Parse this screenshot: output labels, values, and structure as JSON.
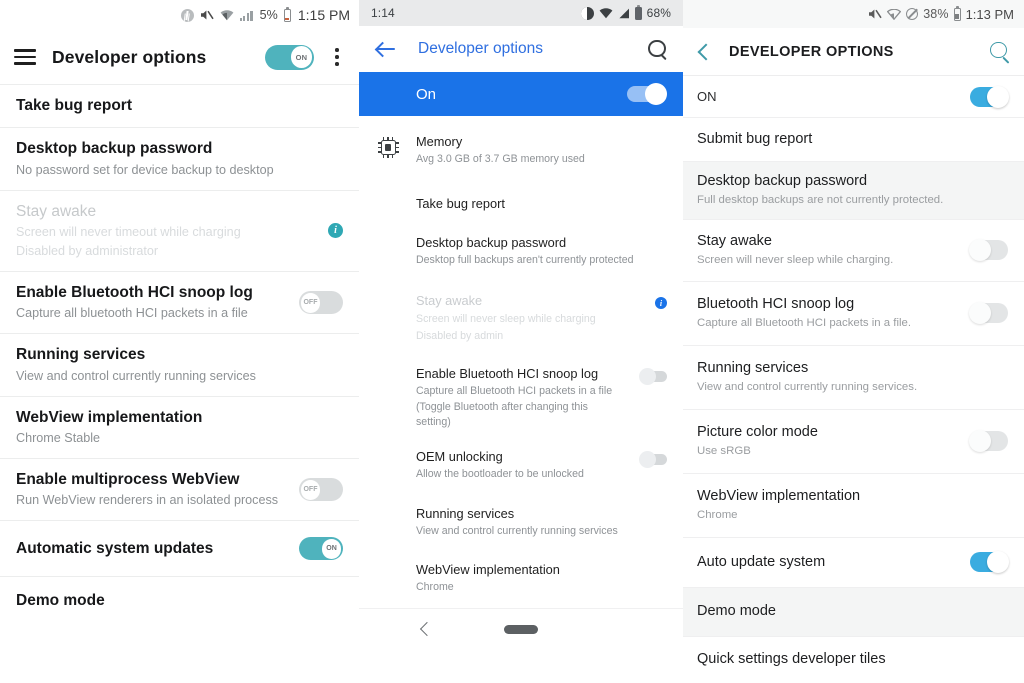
{
  "panel_left": {
    "status_bar": {
      "icons": [
        "bluetooth-icon",
        "volume-mute-icon",
        "wifi-icon",
        "cellular-signal-icon",
        "battery-icon"
      ],
      "battery_percent": "5%",
      "time": "1:15 PM"
    },
    "app_bar": {
      "menu_icon": "hamburger-menu-icon",
      "title": "Developer options",
      "master_toggle": {
        "label": "ON",
        "state": "on"
      },
      "overflow_icon": "kebab-menu-icon"
    },
    "rows": [
      {
        "title": "Take bug report",
        "subtitle": "",
        "control": "none",
        "dim": false
      },
      {
        "title": "Desktop backup password",
        "subtitle": "No password set for device backup to desktop",
        "control": "none",
        "dim": false
      },
      {
        "title": "Stay awake",
        "subtitle": "Screen will never timeout while charging",
        "subtitle2": "Disabled by administrator",
        "control": "info",
        "dim": true
      },
      {
        "title": "Enable Bluetooth HCI snoop log",
        "subtitle": "Capture all bluetooth HCI packets in a file",
        "control": "toggle",
        "toggle_label": "OFF",
        "toggle_state": "off",
        "dim": false
      },
      {
        "title": "Running services",
        "subtitle": "View and control currently running services",
        "control": "none",
        "dim": false
      },
      {
        "title": "WebView implementation",
        "subtitle": "Chrome Stable",
        "control": "none",
        "dim": false
      },
      {
        "title": "Enable multiprocess WebView",
        "subtitle": "Run WebView renderers in an isolated process",
        "control": "toggle",
        "toggle_label": "OFF",
        "toggle_state": "off",
        "dim": false
      },
      {
        "title": "Automatic system updates",
        "subtitle": "",
        "control": "toggle",
        "toggle_label": "ON",
        "toggle_state": "on",
        "dim": false
      },
      {
        "title": "Demo mode",
        "subtitle": "",
        "control": "none",
        "dim": false
      }
    ]
  },
  "panel_middle": {
    "status_bar": {
      "time": "1:14",
      "icons": [
        "do-not-disturb-icon",
        "wifi-icon",
        "cellular-signal-icon",
        "battery-icon"
      ],
      "battery_percent": "68%"
    },
    "app_bar": {
      "back_icon": "back-arrow-icon",
      "title": "Developer options",
      "search_icon": "search-icon"
    },
    "banner": {
      "label": "On",
      "state": "on"
    },
    "rows": [
      {
        "icon": "memory-chip-icon",
        "title": "Memory",
        "subtitle": "Avg 3.0 GB of 3.7 GB memory used",
        "control": "none",
        "dim": false
      },
      {
        "icon": "",
        "title": "Take bug report",
        "subtitle": "",
        "control": "none",
        "dim": false
      },
      {
        "icon": "",
        "title": "Desktop backup password",
        "subtitle": "Desktop full backups aren't currently protected",
        "control": "none",
        "dim": false
      },
      {
        "icon": "",
        "title": "Stay awake",
        "subtitle": "Screen will never sleep while charging",
        "subtitle2": "Disabled by admin",
        "control": "info",
        "dim": true
      },
      {
        "icon": "",
        "title": "Enable Bluetooth HCI snoop log",
        "subtitle": "Capture all Bluetooth HCI packets in a file (Toggle Bluetooth after changing this setting)",
        "control": "toggle",
        "toggle_state": "off",
        "dim": false
      },
      {
        "icon": "",
        "title": "OEM unlocking",
        "subtitle": "Allow the bootloader to be unlocked",
        "control": "toggle",
        "toggle_state": "off",
        "dim": false
      },
      {
        "icon": "",
        "title": "Running services",
        "subtitle": "View and control currently running services",
        "control": "none",
        "dim": false
      },
      {
        "icon": "",
        "title": "WebView implementation",
        "subtitle": "Chrome",
        "control": "none",
        "dim": false
      }
    ],
    "nav_bar": {
      "back_icon": "nav-back-icon",
      "home_icon": "nav-home-pill-icon"
    }
  },
  "panel_right": {
    "status_bar": {
      "icons": [
        "volume-mute-icon",
        "wifi-icon",
        "do-not-disturb-icon",
        "battery-icon"
      ],
      "battery_percent": "38%",
      "time": "1:13 PM"
    },
    "app_bar": {
      "back_icon": "chevron-back-icon",
      "title": "DEVELOPER OPTIONS",
      "search_icon": "search-icon"
    },
    "rows": [
      {
        "title": "ON",
        "subtitle": "",
        "control": "toggle",
        "toggle_state": "on",
        "shade": false,
        "caps": true
      },
      {
        "title": "Submit bug report",
        "subtitle": "",
        "control": "none",
        "shade": false
      },
      {
        "title": "Desktop backup password",
        "subtitle": "Full desktop backups are not currently protected.",
        "control": "none",
        "shade": true
      },
      {
        "title": "Stay awake",
        "subtitle": "Screen will never sleep while charging.",
        "control": "toggle",
        "toggle_state": "off",
        "shade": false
      },
      {
        "title": "Bluetooth HCI snoop log",
        "subtitle": "Capture all Bluetooth HCI packets in a file.",
        "control": "toggle",
        "toggle_state": "off",
        "shade": false
      },
      {
        "title": "Running services",
        "subtitle": "View and control currently running services.",
        "control": "none",
        "shade": false
      },
      {
        "title": "Picture color mode",
        "subtitle": "Use sRGB",
        "control": "toggle",
        "toggle_state": "off",
        "shade": false
      },
      {
        "title": "WebView implementation",
        "subtitle": "Chrome",
        "control": "none",
        "shade": false
      },
      {
        "title": "Auto update system",
        "subtitle": "",
        "control": "toggle",
        "toggle_state": "on",
        "shade": false
      },
      {
        "title": "Demo mode",
        "subtitle": "",
        "control": "none",
        "shade": true
      },
      {
        "title": "Quick settings developer tiles",
        "subtitle": "",
        "control": "none",
        "shade": false
      }
    ]
  },
  "colors": {
    "teal_accent": "#4fb3bd",
    "blue_accent": "#1a73e8",
    "samsung_blue": "#3aace0",
    "samsung_teal": "#3f9aa8"
  }
}
